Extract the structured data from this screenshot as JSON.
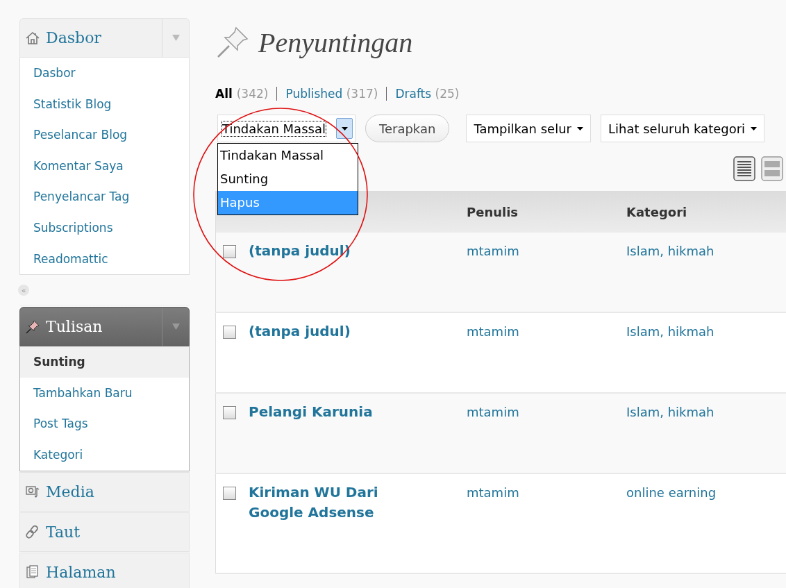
{
  "sidebar": {
    "groups": [
      {
        "label": "Dasbor",
        "expanded": true,
        "active": false,
        "items": [
          {
            "label": "Dasbor",
            "selected": false
          },
          {
            "label": "Statistik Blog",
            "selected": false
          },
          {
            "label": "Peselancar Blog",
            "selected": false
          },
          {
            "label": "Komentar Saya",
            "selected": false
          },
          {
            "label": "Penyelancar Tag",
            "selected": false
          },
          {
            "label": "Subscriptions",
            "selected": false
          },
          {
            "label": "Readomattic",
            "selected": false
          }
        ]
      },
      {
        "label": "Tulisan",
        "expanded": true,
        "active": true,
        "items": [
          {
            "label": "Sunting",
            "selected": true
          },
          {
            "label": "Tambahkan Baru",
            "selected": false
          },
          {
            "label": "Post Tags",
            "selected": false
          },
          {
            "label": "Kategori",
            "selected": false
          }
        ]
      },
      {
        "label": "Media",
        "expanded": false,
        "active": false
      },
      {
        "label": "Taut",
        "expanded": false,
        "active": false
      },
      {
        "label": "Halaman",
        "expanded": false,
        "active": false
      }
    ],
    "collapse_glyph": "«"
  },
  "page_title": "Penyuntingan",
  "status_filters": [
    {
      "label": "All",
      "count": "(342)",
      "selected": true
    },
    {
      "label": "Published",
      "count": "(317)",
      "selected": false
    },
    {
      "label": "Drafts",
      "count": "(25)",
      "selected": false
    }
  ],
  "bulk_actions": {
    "value": "Tindakan Massal",
    "expanded": true,
    "options": [
      {
        "label": "Tindakan Massal",
        "highlighted": false
      },
      {
        "label": "Sunting",
        "highlighted": false
      },
      {
        "label": "Hapus",
        "highlighted": true
      }
    ]
  },
  "apply_button": "Terapkan",
  "filters": [
    "Tampilkan selur",
    "Lihat seluruh kategori"
  ],
  "table": {
    "columns": [
      "Penulis",
      "Kategori"
    ],
    "rows": [
      {
        "title": "(tanpa judul)",
        "author": "mtamim",
        "category": "Islam, hikmah",
        "checked": false
      },
      {
        "title": "(tanpa judul)",
        "author": "mtamim",
        "category": "Islam, hikmah",
        "checked": false
      },
      {
        "title": "Pelangi Karunia",
        "author": "mtamim",
        "category": "Islam, hikmah",
        "checked": false
      },
      {
        "title": "Kiriman WU Dari Google Adsense",
        "author": "mtamim",
        "category": "online earning",
        "checked": false
      }
    ]
  },
  "annotation": {
    "kind": "circle"
  }
}
